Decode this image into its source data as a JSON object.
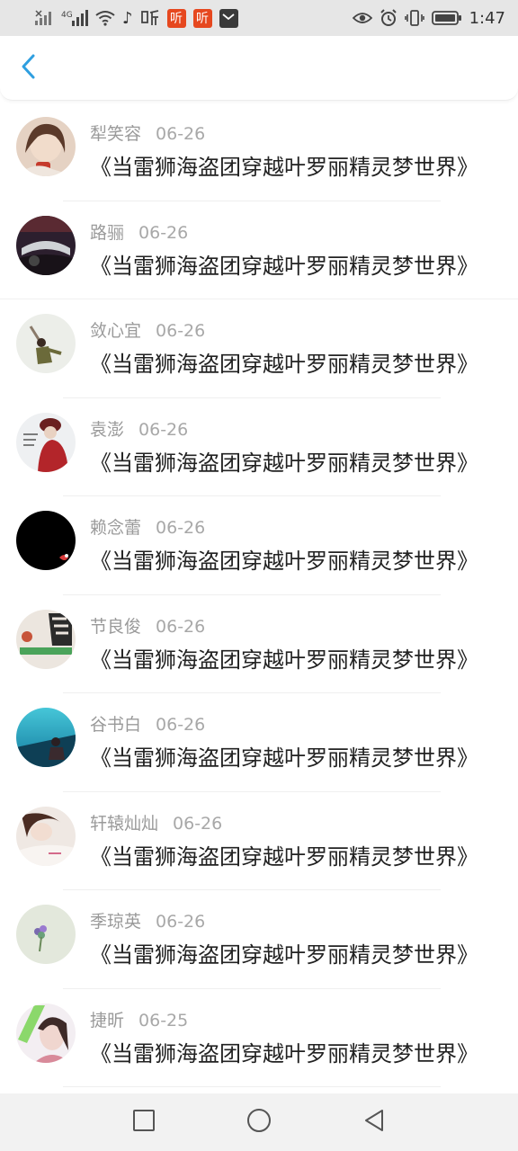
{
  "status_bar": {
    "badges": [
      "听",
      "听"
    ],
    "time": "1:47",
    "icons": [
      "signal-icon",
      "signal-4g-icon",
      "wifi-icon",
      "music-note-icon",
      "listen-icon",
      "app-badge-icon",
      "eye-icon",
      "alarm-icon",
      "vibrate-icon",
      "battery-icon"
    ]
  },
  "header": {
    "back_icon": "chevron-left-icon",
    "accent": "#2f9fe0"
  },
  "list": {
    "items": [
      {
        "name": "犁笑容",
        "date": "06-26",
        "title": "《当雷狮海盗团穿越叶罗丽精灵梦世界》",
        "avatar_color": "#d8b7a4"
      },
      {
        "name": "路骊",
        "date": "06-26",
        "title": "《当雷狮海盗团穿越叶罗丽精灵梦世界》",
        "avatar_color": "#3a2a3e"
      },
      {
        "name": "敛心宜",
        "date": "06-26",
        "title": "《当雷狮海盗团穿越叶罗丽精灵梦世界》",
        "avatar_color": "#e9ebe6"
      },
      {
        "name": "袁澎",
        "date": "06-26",
        "title": "《当雷狮海盗团穿越叶罗丽精灵梦世界》",
        "avatar_color": "#b7262c"
      },
      {
        "name": "赖念蕾",
        "date": "06-26",
        "title": "《当雷狮海盗团穿越叶罗丽精灵梦世界》",
        "avatar_color": "#000000"
      },
      {
        "name": "节良俊",
        "date": "06-26",
        "title": "《当雷狮海盗团穿越叶罗丽精灵梦世界》",
        "avatar_color": "#d9c9b8"
      },
      {
        "name": "谷书白",
        "date": "06-26",
        "title": "《当雷狮海盗团穿越叶罗丽精灵梦世界》",
        "avatar_color": "#1f9ec7"
      },
      {
        "name": "轩辕灿灿",
        "date": "06-26",
        "title": "《当雷狮海盗团穿越叶罗丽精灵梦世界》",
        "avatar_color": "#e8ddd6"
      },
      {
        "name": "季琼英",
        "date": "06-26",
        "title": "《当雷狮海盗团穿越叶罗丽精灵梦世界》",
        "avatar_color": "#dfe6d9"
      },
      {
        "name": "捷昕",
        "date": "06-25",
        "title": "《当雷狮海盗团穿越叶罗丽精灵梦世界》",
        "avatar_color": "#c7e9b6"
      }
    ]
  },
  "nav_bar": {
    "buttons": [
      "recents-square-icon",
      "home-circle-icon",
      "back-triangle-icon"
    ]
  }
}
